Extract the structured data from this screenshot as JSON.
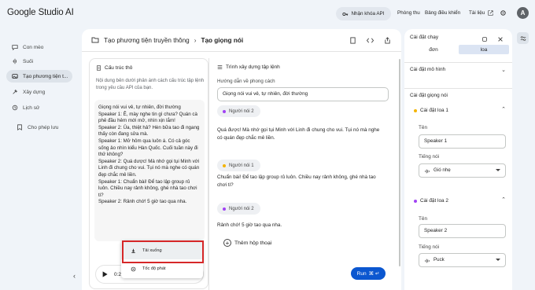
{
  "app": {
    "logo": "Google Studio AI"
  },
  "topbar": {
    "api_key": "Nhận khóa API",
    "playground": "Phòng thu",
    "dashboard": "Bảng điều khiển",
    "docs": "Tài liệu",
    "avatar": "A"
  },
  "sidebar": {
    "items": [
      {
        "label": "Con mèo",
        "icon": "chat-icon"
      },
      {
        "label": "Suối",
        "icon": "stream-icon"
      },
      {
        "label": "Tạo phương tiện t...",
        "icon": "media-icon"
      },
      {
        "label": "Xây dựng",
        "icon": "build-icon"
      },
      {
        "label": "Lịch sử",
        "icon": "history-icon"
      },
      {
        "label": "Cho phép lưu",
        "icon": "save-icon"
      }
    ]
  },
  "main": {
    "breadcrumb_parent": "Tạo phương tiện truyền thông",
    "breadcrumb_current": "Tạo giọng nói",
    "structure": {
      "title": "Cấu trúc thô",
      "description": "Nội dung bên dưới phản ánh cách cấu trúc tập lệnh trong yêu cầu API của bạn.",
      "body": "Giọng nói vui vẻ, tự nhiên, đời thường\nSpeaker 1: Ê, mày nghe tin gì chưa? Quán cà phê đầu hẻm mới mở, nhìn xịn lắm!\nSpeaker 2: Ủa, thiệt hả? Hèn bữa tao đi ngang thấy còn đang sửa mà.\nSpeaker 1: Mở hôm qua luôn á. Có cả góc sống ảo nhìn kiểu Hàn Quốc. Cuối tuần này đi thử không?\nSpeaker 2: Quá dược! Mà nhớ gọi tụi Minh với Linh đi chung cho vui. Tụi nó mà nghe có quán đẹp chắc mê liền.\nSpeaker 1: Chuẩn bài! Để tao lập group rủ luôn. Chiều nay rảnh không, ghé nhà tao chơi ti?\nSpeaker 2: Rảnh chớ! 5 giờ tao qua nha."
    },
    "player": {
      "time": "0:25 /"
    },
    "popup": {
      "download": "Tải xuống",
      "speed": "Tốc độ phát"
    },
    "builder": {
      "title": "Trình xây dựng tập lệnh",
      "style_label": "Hướng dẫn về phong cách",
      "style_value": "Giọng nói vui vẻ, tự nhiên, đời thường",
      "speaker2": "Người nói 2",
      "speaker1": "Người nói 1",
      "line1": "Quá được! Mà nhớ gọi tụi Minh với Linh đi chung cho vui. Tụi nó mà nghe có quán đẹp chắc mê liền.",
      "line2": "Chuẩn bài! Để tao lập group rủ luôn. Chiều nay rảnh không, ghé nhà tao chơi ti?",
      "line3": "Rảnh chớ! 5 giờ tao qua nha.",
      "add_dialog": "Thêm hộp thoại",
      "run": "Run"
    }
  },
  "settings": {
    "header": "Cài đặt chạy",
    "tab_single": "đơn",
    "tab_multi": "loa",
    "model_settings": "Cài đặt mô hình",
    "voice_settings": "Cài đặt giọng nói",
    "speaker1": {
      "title": "Cài đặt loa 1",
      "name_label": "Tên",
      "name_value": "Speaker 1",
      "voice_label": "Tiếng nói",
      "voice_value": "Gió nhẹ"
    },
    "speaker2": {
      "title": "Cài đặt loa 2",
      "name_label": "Tên",
      "name_value": "Speaker 2",
      "voice_label": "Tiếng nói",
      "voice_value": "Puck"
    }
  },
  "colors": {
    "accent": "#0b57d0",
    "speaker1_dot": "#f4b400",
    "speaker2_dot": "#a142f4",
    "highlight": "#d62728"
  }
}
